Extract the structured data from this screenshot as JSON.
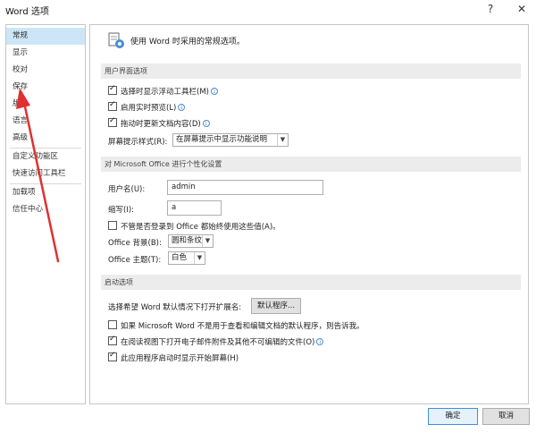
{
  "window": {
    "title": "Word 选项",
    "help_glyph": "?",
    "close_glyph": "✕"
  },
  "sidebar": {
    "items": [
      {
        "label": "常规"
      },
      {
        "label": "显示"
      },
      {
        "label": "校对"
      },
      {
        "label": "保存"
      },
      {
        "label": "版式"
      },
      {
        "label": "语言"
      },
      {
        "label": "高级"
      },
      {
        "label": "自定义功能区"
      },
      {
        "label": "快速访问工具栏"
      },
      {
        "label": "加载项"
      },
      {
        "label": "信任中心"
      }
    ],
    "selected": "常规"
  },
  "content": {
    "intro": "使用 Word 时采用的常规选项。",
    "ui_section": {
      "header": "用户界面选项",
      "show_minitoolbar": "选择时显示浮动工具栏(M)",
      "live_preview": "启用实时预览(L)",
      "update_drag": "拖动时更新文档内容(D)",
      "screentip_label": "屏幕提示样式(R):",
      "screentip_value": "在屏幕提示中显示功能说明"
    },
    "personalize_section": {
      "header": "对 Microsoft Office 进行个性化设置",
      "username_label": "用户名(U):",
      "username_value": "admin",
      "initials_label": "缩写(I):",
      "initials_value": "a",
      "always_use": "不管是否登录到 Office 都始终使用这些值(A)。",
      "background_label": "Office 背景(B):",
      "background_value": "圆和条纹",
      "theme_label": "Office 主题(T):",
      "theme_value": "白色"
    },
    "startup_section": {
      "header": "启动选项",
      "default_ext_label": "选择希望 Word 默认情况下打开扩展名:",
      "default_programs_button": "默认程序...",
      "tell_me": "如果 Microsoft Word 不是用于查看和编辑文档的默认程序，则告诉我。",
      "reading_view": "在阅读视图下打开电子邮件附件及其他不可编辑的文件(O)",
      "show_start": "此应用程序启动时显示开始屏幕(H)"
    }
  },
  "footer": {
    "ok": "确定",
    "cancel": "取消"
  },
  "colors": {
    "selected_bg": "#cde6f7",
    "section_bg": "#ececec",
    "annotation_arrow": "#e03030",
    "info_icon": "#4a8ed8"
  }
}
